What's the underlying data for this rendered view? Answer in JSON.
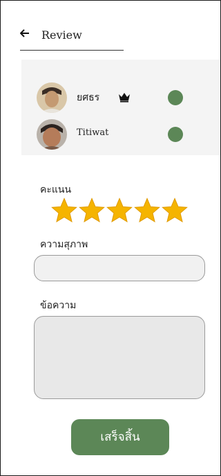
{
  "header": {
    "title": "Review",
    "back_icon": "arrow-left-icon"
  },
  "members": [
    {
      "name": "ยศธร",
      "badge_icon": "crown-icon",
      "status_color": "#5c8757"
    },
    {
      "name": "Titiwat",
      "status_color": "#5c8757"
    }
  ],
  "score": {
    "label": "คะแนน",
    "rating": 5,
    "max": 5,
    "star_color": "#f5b400"
  },
  "politeness": {
    "label": "ความสุภาพ",
    "value": ""
  },
  "message": {
    "label": "ข้อความ",
    "value": ""
  },
  "finish_button": {
    "label": "เสร็จสิ้น",
    "color": "#5c8757"
  }
}
